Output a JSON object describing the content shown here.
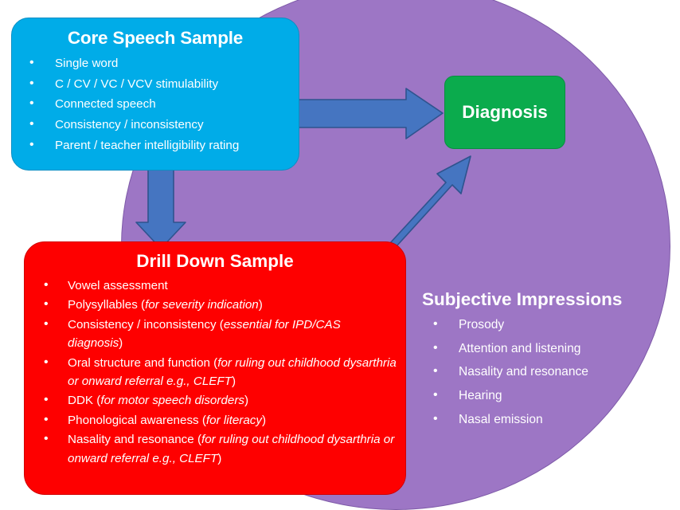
{
  "colors": {
    "ellipse_purple": "#9d76c5",
    "core_blue": "#00ace8",
    "drill_red": "#fe0000",
    "diagnosis_green": "#0bab4d",
    "arrow_blue": "#4575c1",
    "arrow_outline": "#2f538e",
    "text_white": "#ffffff",
    "background": "#ffffff"
  },
  "core_speech_sample": {
    "title": "Core Speech Sample",
    "items": [
      "Single word",
      "C / CV / VC / VCV stimulability",
      "Connected speech",
      "Consistency / inconsistency",
      "Parent / teacher intelligibility rating"
    ]
  },
  "drill_down_sample": {
    "title": "Drill Down Sample",
    "items": [
      {
        "text": "Vowel assessment",
        "note": ""
      },
      {
        "text": "Polysyllables (",
        "note": "for severity indication",
        "after": ")"
      },
      {
        "text": "Consistency / inconsistency (",
        "note": "essential for IPD/CAS diagnosis",
        "after": ")"
      },
      {
        "text": "Oral structure and function (",
        "note": "for ruling out childhood dysarthria or onward referral e.g., CLEFT",
        "after": ")"
      },
      {
        "text": "DDK (",
        "note": "for motor speech disorders",
        "after": ")"
      },
      {
        "text": "Phonological awareness (",
        "note": "for literacy",
        "after": ")"
      },
      {
        "text": "Nasality and resonance (",
        "note": "for ruling out childhood dysarthria or onward referral e.g., CLEFT",
        "after": ")"
      }
    ]
  },
  "diagnosis": {
    "title": "Diagnosis"
  },
  "subjective_impressions": {
    "title": "Subjective Impressions",
    "items": [
      "Prosody",
      "Attention and listening",
      "Nasality and resonance",
      "Hearing",
      "Nasal emission"
    ]
  },
  "arrows": [
    {
      "name": "core-to-diagnosis",
      "from": "Core Speech Sample",
      "to": "Diagnosis",
      "direction": "right"
    },
    {
      "name": "core-to-drill-down",
      "from": "Core Speech Sample",
      "to": "Drill Down Sample",
      "direction": "down"
    },
    {
      "name": "drill-down-to-diagnosis",
      "from": "Drill Down Sample",
      "to": "Diagnosis",
      "direction": "up-right"
    }
  ]
}
